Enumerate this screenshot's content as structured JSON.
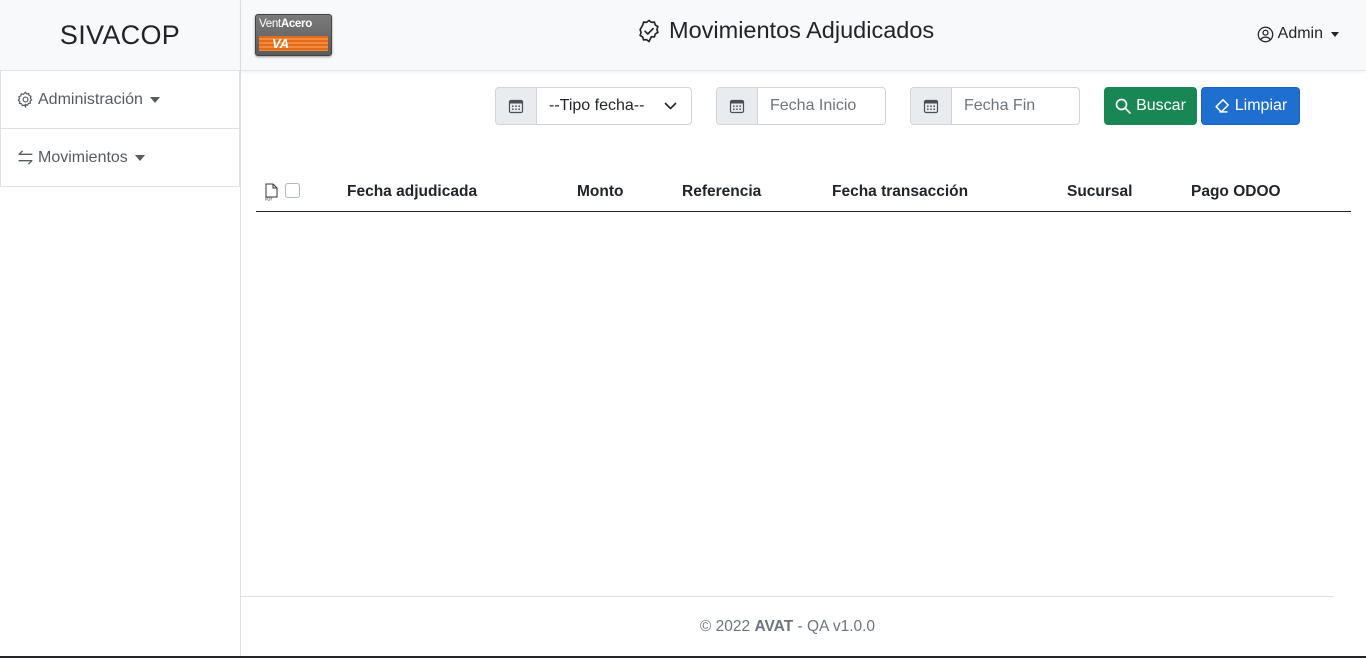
{
  "brand": "SIVACOP",
  "logo": {
    "text_vent": "Vent",
    "text_acero": "Acero",
    "mark": "VA"
  },
  "sidebar": {
    "items": [
      {
        "label": "Administración",
        "icon": "gear-icon"
      },
      {
        "label": "Movimientos",
        "icon": "swap-arrows-icon"
      }
    ]
  },
  "header": {
    "title": "Movimientos Adjudicados",
    "title_icon": "badge-check-icon",
    "user": "Admin"
  },
  "filters": {
    "tipo_fecha": "--Tipo fecha--",
    "fecha_inicio_placeholder": "Fecha Inicio",
    "fecha_fin_placeholder": "Fecha Fin",
    "buscar_label": "Buscar",
    "limpiar_label": "Limpiar"
  },
  "table": {
    "columns": [
      "Fecha adjudicada",
      "Monto",
      "Referencia",
      "Fecha transacción",
      "Sucursal",
      "Pago ODOO"
    ],
    "rows": []
  },
  "footer": {
    "copyright": "© 2022",
    "company": "AVAT",
    "version": "- QA v1.0.0"
  },
  "colors": {
    "buscar": "#198754",
    "limpiar": "#1e6fd0",
    "logo_orange": "#e46a1a"
  }
}
